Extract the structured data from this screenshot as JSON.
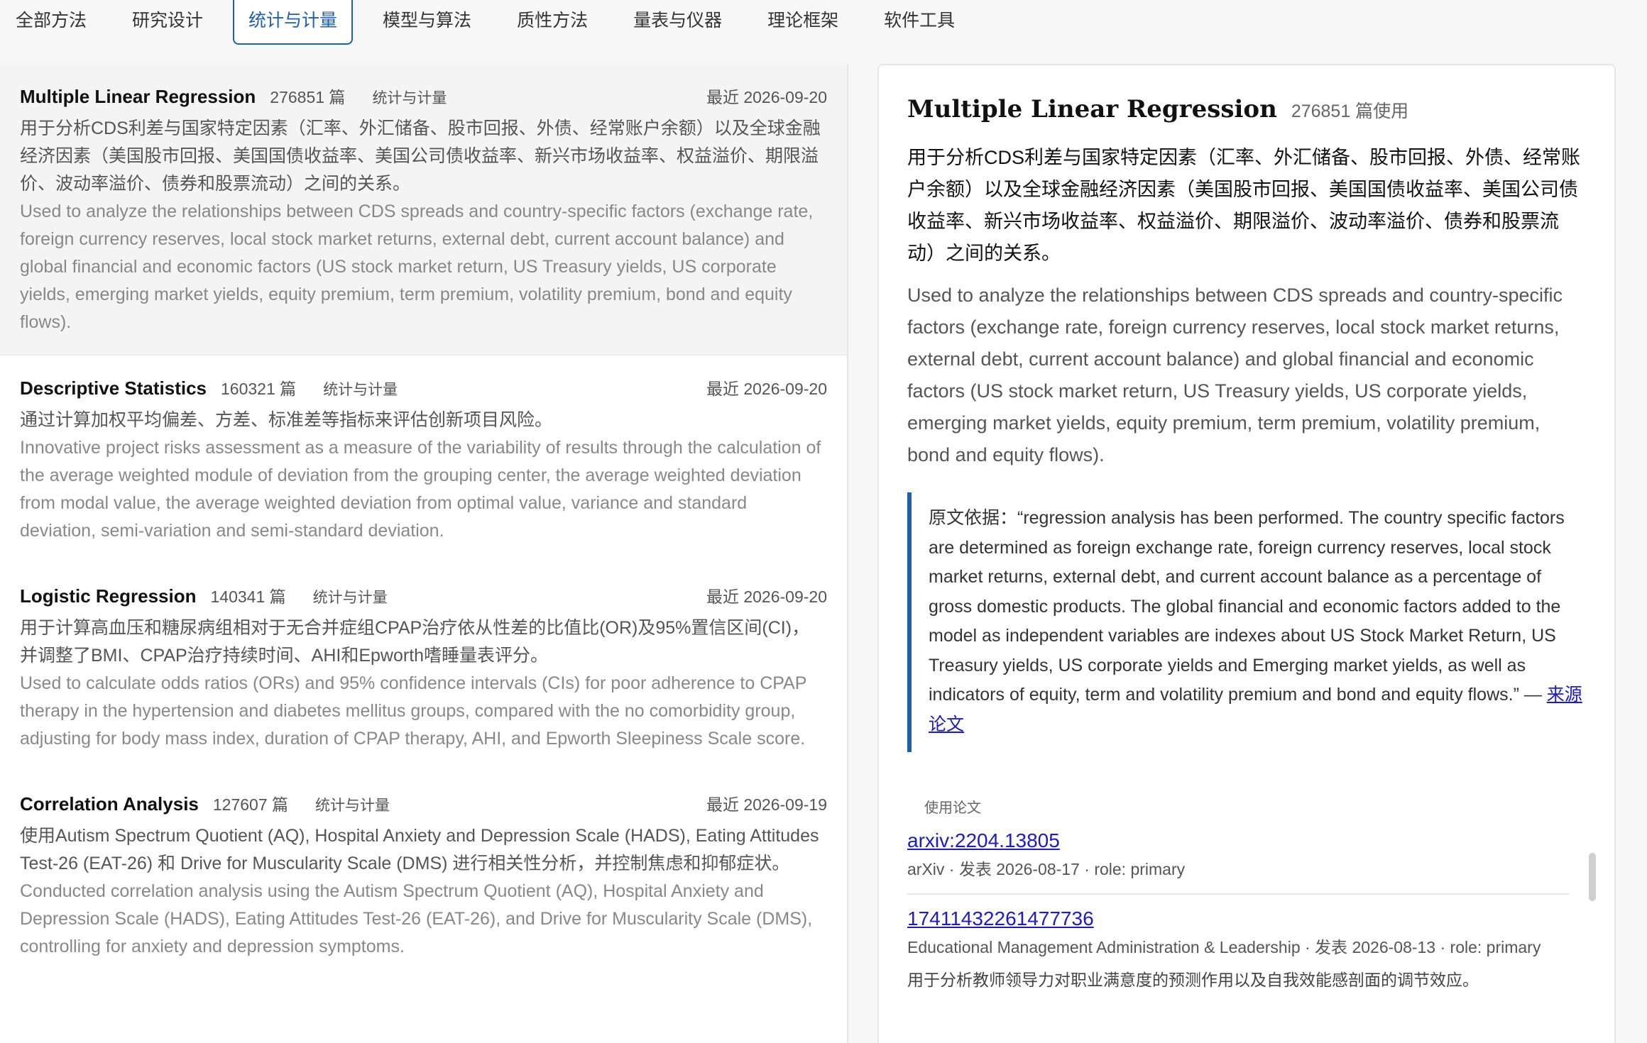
{
  "tabs": [
    {
      "label": "全部方法",
      "active": false
    },
    {
      "label": "研究设计",
      "active": false
    },
    {
      "label": "统计与计量",
      "active": true
    },
    {
      "label": "模型与算法",
      "active": false
    },
    {
      "label": "质性方法",
      "active": false
    },
    {
      "label": "量表与仪器",
      "active": false
    },
    {
      "label": "理论框架",
      "active": false
    },
    {
      "label": "软件工具",
      "active": false
    }
  ],
  "methods": [
    {
      "title": "Multiple Linear Regression",
      "count": "276851 篇",
      "tag": "统计与计量",
      "date": "最近 2026-09-20",
      "desc_cn": "用于分析CDS利差与国家特定因素（汇率、外汇储备、股市回报、外债、经常账户余额）以及全球金融经济因素（美国股市回报、美国国债收益率、美国公司债收益率、新兴市场收益率、权益溢价、期限溢价、波动率溢价、债券和股票流动）之间的关系。",
      "desc_en": "Used to analyze the relationships between CDS spreads and country-specific factors (exchange rate, foreign currency reserves, local stock market returns, external debt, current account balance) and global financial and economic factors (US stock market return, US Treasury yields, US corporate yields, emerging market yields, equity premium, term premium, volatility premium, bond and equity flows)."
    },
    {
      "title": "Descriptive Statistics",
      "count": "160321 篇",
      "tag": "统计与计量",
      "date": "最近 2026-09-20",
      "desc_cn": "通过计算加权平均偏差、方差、标准差等指标来评估创新项目风险。",
      "desc_en": "Innovative project risks assessment as a measure of the variability of results through the calculation of the average weighted module of deviation from the grouping center, the average weighted deviation from modal value, the average weighted deviation from optimal value, variance and standard deviation, semi-variation and semi-standard deviation."
    },
    {
      "title": "Logistic Regression",
      "count": "140341 篇",
      "tag": "统计与计量",
      "date": "最近 2026-09-20",
      "desc_cn": "用于计算高血压和糖尿病组相对于无合并症组CPAP治疗依从性差的比值比(OR)及95%置信区间(CI)，并调整了BMI、CPAP治疗持续时间、AHI和Epworth嗜睡量表评分。",
      "desc_en": "Used to calculate odds ratios (ORs) and 95% confidence intervals (CIs) for poor adherence to CPAP therapy in the hypertension and diabetes mellitus groups, compared with the no comorbidity group, adjusting for body mass index, duration of CPAP therapy, AHI, and Epworth Sleepiness Scale score."
    },
    {
      "title": "Correlation Analysis",
      "count": "127607 篇",
      "tag": "统计与计量",
      "date": "最近 2026-09-19",
      "desc_cn": "使用Autism Spectrum Quotient (AQ), Hospital Anxiety and Depression Scale (HADS), Eating Attitudes Test-26 (EAT-26) 和 Drive for Muscularity Scale (DMS) 进行相关性分析，并控制焦虑和抑郁症状。",
      "desc_en": "Conducted correlation analysis using the Autism Spectrum Quotient (AQ), Hospital Anxiety and Depression Scale (HADS), Eating Attitudes Test-26 (EAT-26), and Drive for Muscularity Scale (DMS), controlling for anxiety and depression symptoms."
    }
  ],
  "detail": {
    "title": "Multiple Linear Regression",
    "count": "276851 篇使用",
    "desc_cn": "用于分析CDS利差与国家特定因素（汇率、外汇储备、股市回报、外债、经常账户余额）以及全球金融经济因素（美国股市回报、美国国债收益率、美国公司债收益率、新兴市场收益率、权益溢价、期限溢价、波动率溢价、债券和股票流动）之间的关系。",
    "desc_en": "Used to analyze the relationships between CDS spreads and country-specific factors (exchange rate, foreign currency reserves, local stock market returns, external debt, current account balance) and global financial and economic factors (US stock market return, US Treasury yields, US corporate yields, emerging market yields, equity premium, term premium, volatility premium, bond and equity flows).",
    "quote_text": "原文依据：“regression analysis has been performed. The country specific factors are determined as foreign exchange rate, foreign currency reserves, local stock market returns, external debt, and current account balance as a percentage of gross domestic products. The global financial and economic factors added to the model as independent variables are indexes about US Stock Market Return, US Treasury yields, US corporate yields and Emerging market yields, as well as indicators of equity, term and volatility premium and bond and equity flows.” — ",
    "quote_link": "来源论文",
    "papers_label": "使用论文",
    "papers": [
      {
        "id": "arxiv:2204.13805",
        "meta": "arXiv · 发表 2026-08-17 · role: primary",
        "desc": ""
      },
      {
        "id": "17411432261477736",
        "meta": "Educational Management Administration & Leadership · 发表 2026-08-13 · role: primary",
        "desc": "用于分析教师领导力对职业满意度的预测作用以及自我效能感剖面的调节效应。"
      }
    ]
  },
  "colors": {
    "accent": "#1f5fae",
    "link": "#1a1ad1"
  }
}
